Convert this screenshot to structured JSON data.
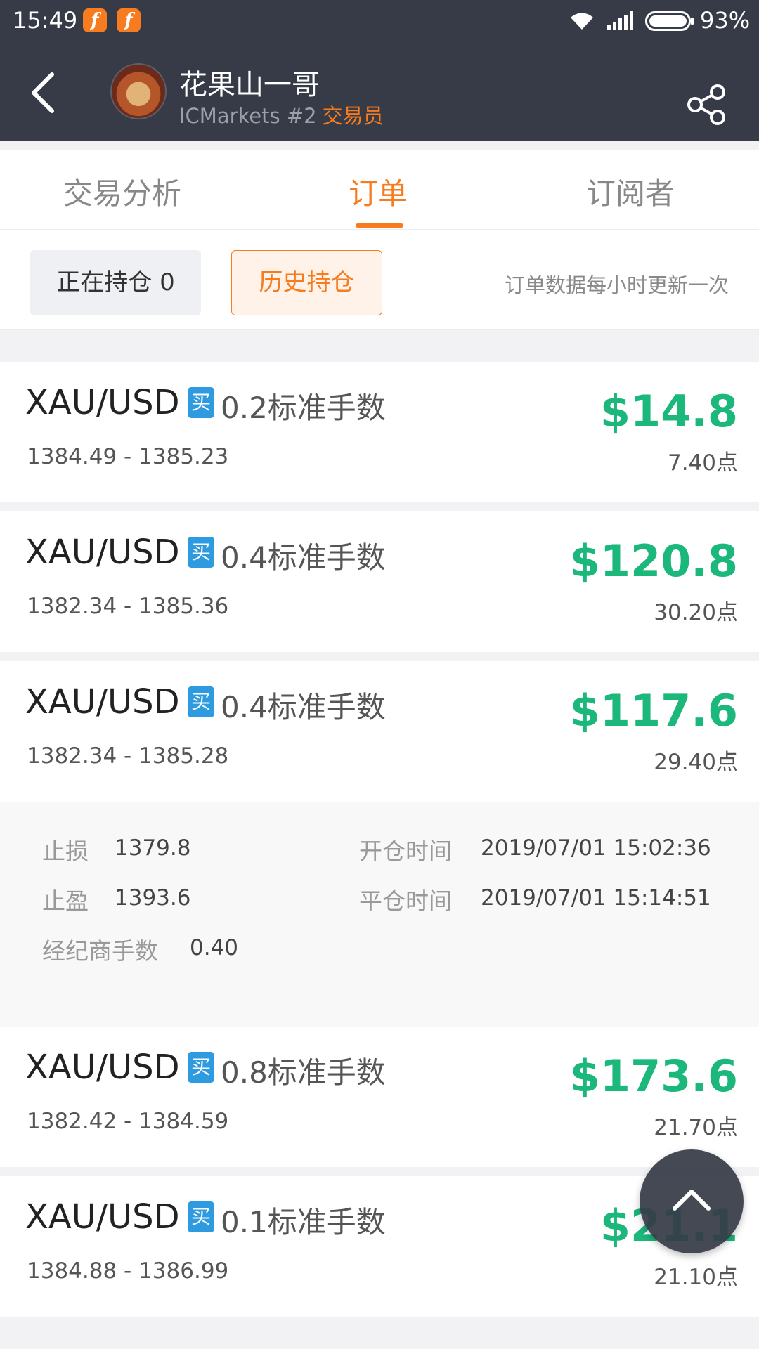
{
  "status_bar": {
    "time": "15:49",
    "battery": "93%",
    "notification_icons": [
      "app-f-icon",
      "app-f-icon"
    ]
  },
  "header": {
    "trader_name": "花果山一哥",
    "broker_rank": "ICMarkets #2",
    "role": "交易员"
  },
  "tabs": [
    {
      "label": "交易分析",
      "active": false
    },
    {
      "label": "订单",
      "active": true
    },
    {
      "label": "订阅者",
      "active": false
    }
  ],
  "filter": {
    "open_positions_label": "正在持仓 0",
    "history_label": "历史持仓",
    "update_note": "订单数据每小时更新一次"
  },
  "orders": [
    {
      "symbol": "XAU/USD",
      "side": "买",
      "lots": "0.2标准手数",
      "range": "1384.49 - 1385.23",
      "profit": "$14.8",
      "points": "7.40点"
    },
    {
      "symbol": "XAU/USD",
      "side": "买",
      "lots": "0.4标准手数",
      "range": "1382.34 - 1385.36",
      "profit": "$120.8",
      "points": "30.20点"
    },
    {
      "symbol": "XAU/USD",
      "side": "买",
      "lots": "0.4标准手数",
      "range": "1382.34 - 1385.28",
      "profit": "$117.6",
      "points": "29.40点"
    },
    {
      "symbol": "XAU/USD",
      "side": "买",
      "lots": "0.8标准手数",
      "range": "1382.42 - 1384.59",
      "profit": "$173.6",
      "points": "21.70点"
    },
    {
      "symbol": "XAU/USD",
      "side": "买",
      "lots": "0.1标准手数",
      "range": "1384.88 - 1386.99",
      "profit": "$21.1",
      "points": "21.10点"
    }
  ],
  "details": {
    "stop_loss_label": "止损",
    "stop_loss": "1379.8",
    "take_profit_label": "止盈",
    "take_profit": "1393.6",
    "broker_lots_label": "经纪商手数",
    "broker_lots": "0.40",
    "open_time_label": "开仓时间",
    "open_time": "2019/07/01 15:02:36",
    "close_time_label": "平仓时间",
    "close_time": "2019/07/01 15:14:51"
  },
  "colors": {
    "header_bg": "#363b47",
    "accent": "#f77b1f",
    "profit": "#1bb77b",
    "buy_badge": "#2e9ae0"
  }
}
